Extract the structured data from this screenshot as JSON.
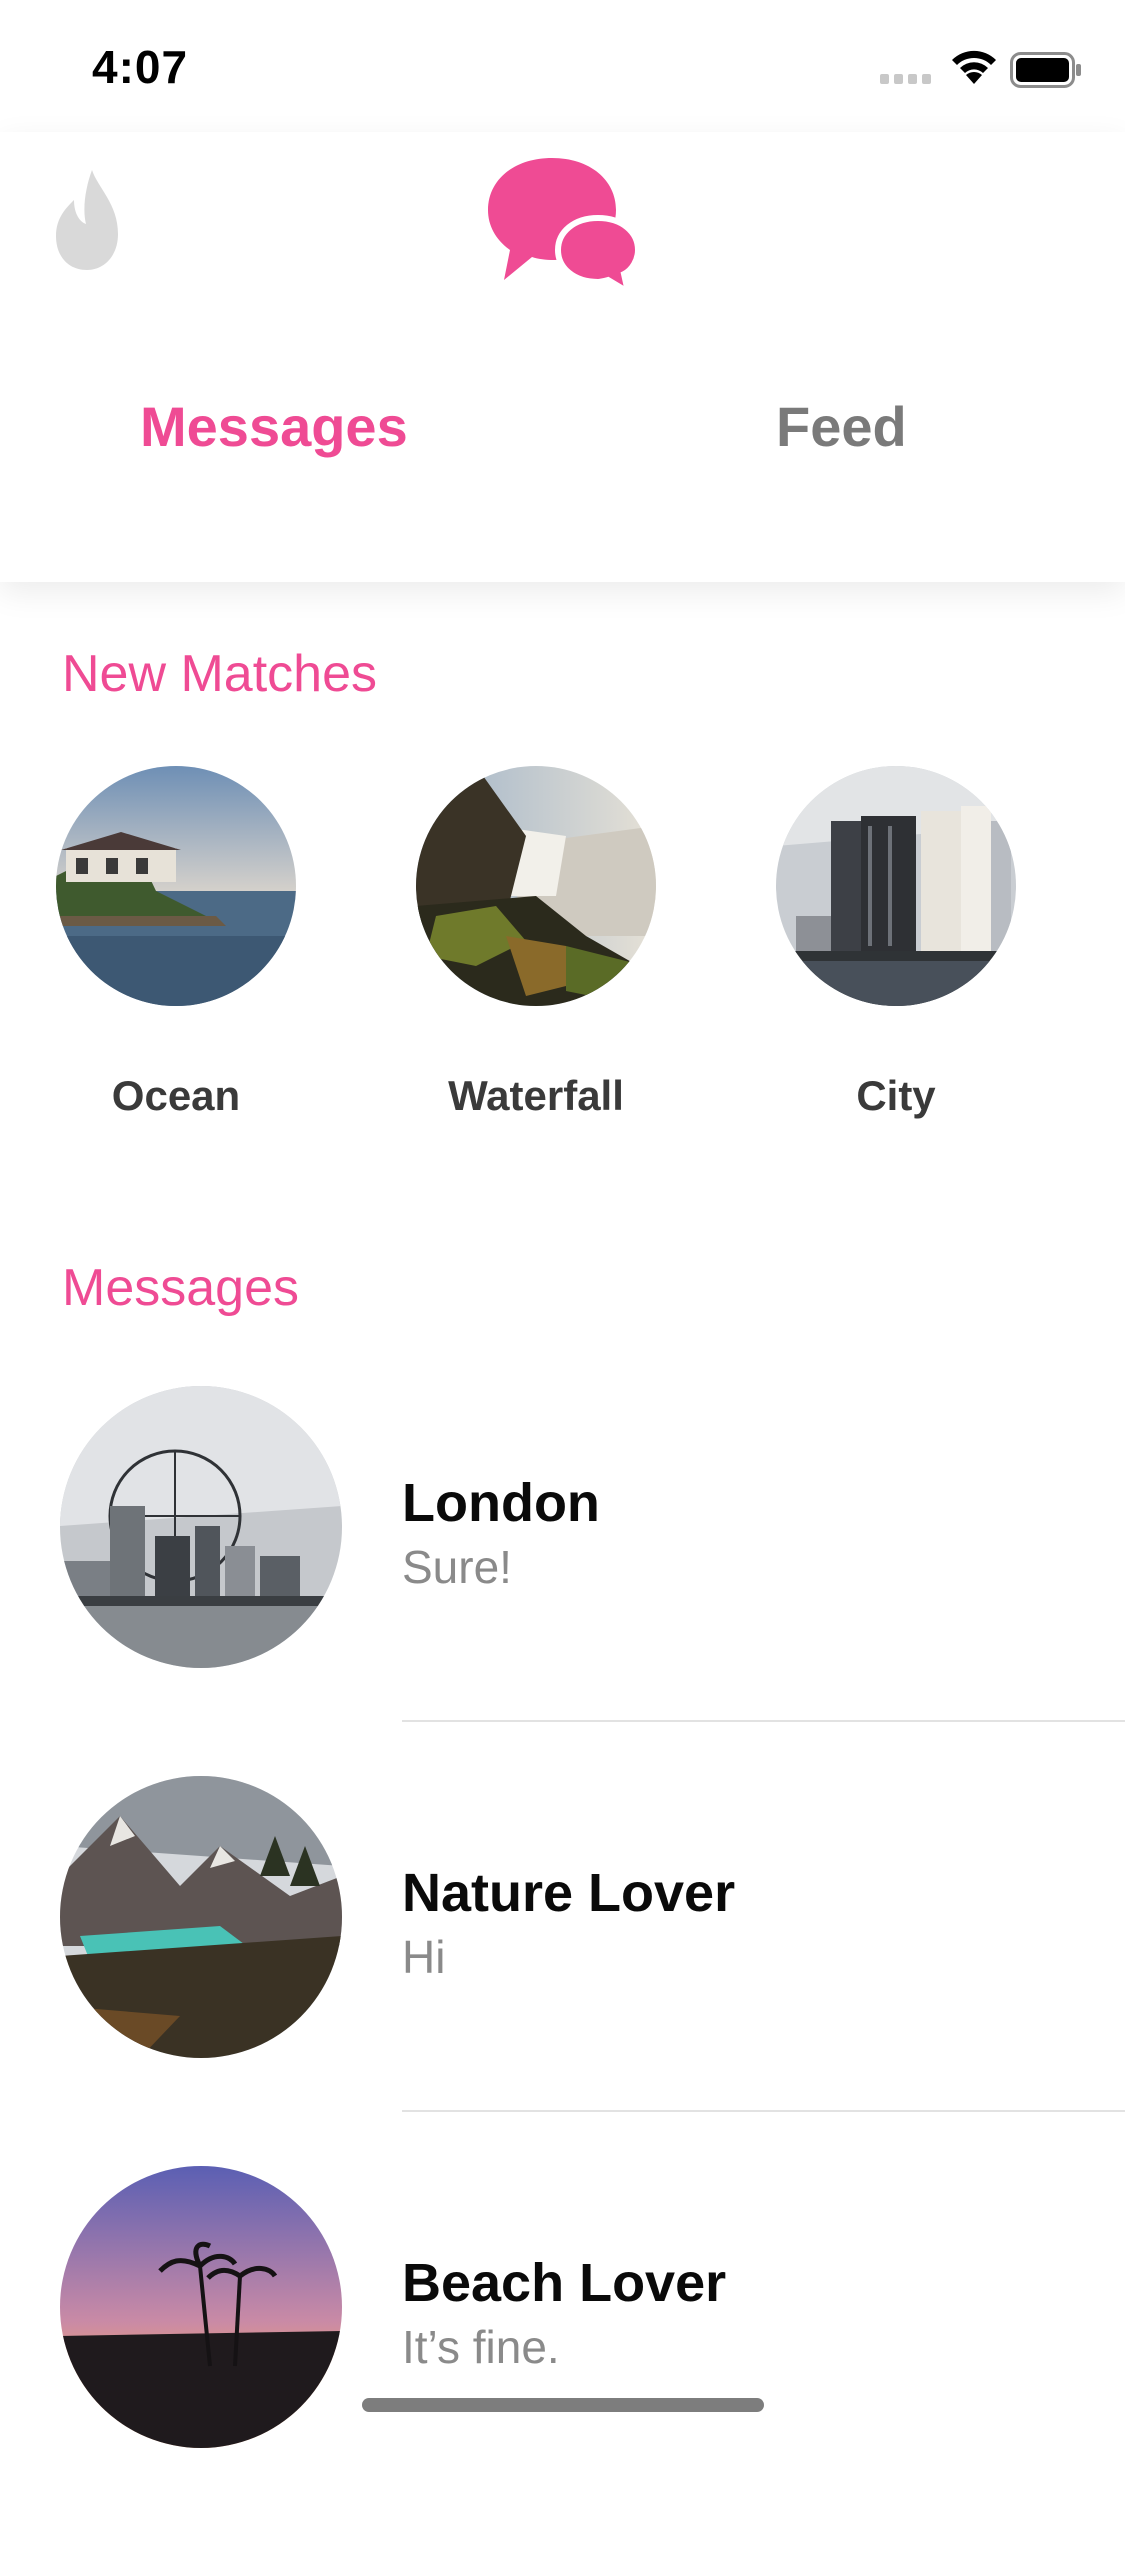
{
  "status_bar": {
    "time": "4:07"
  },
  "header": {
    "tabs": [
      {
        "label": "Messages",
        "active": true
      },
      {
        "label": "Feed",
        "active": false
      }
    ]
  },
  "new_matches": {
    "title": "New Matches",
    "items": [
      {
        "name": "Ocean"
      },
      {
        "name": "Waterfall"
      },
      {
        "name": "City"
      }
    ]
  },
  "messages": {
    "title": "Messages",
    "items": [
      {
        "name": "London",
        "preview": "Sure!"
      },
      {
        "name": "Nature Lover",
        "preview": "Hi"
      },
      {
        "name": "Beach Lover",
        "preview": "It’s fine."
      }
    ]
  },
  "colors": {
    "accent": "#ef4b94",
    "inactive_tab": "#7a7a7a",
    "icon_gray": "#d9d9d9"
  },
  "icons": [
    "flame-icon",
    "chat-bubbles-icon",
    "wifi-icon",
    "battery-icon",
    "signal-icon"
  ]
}
